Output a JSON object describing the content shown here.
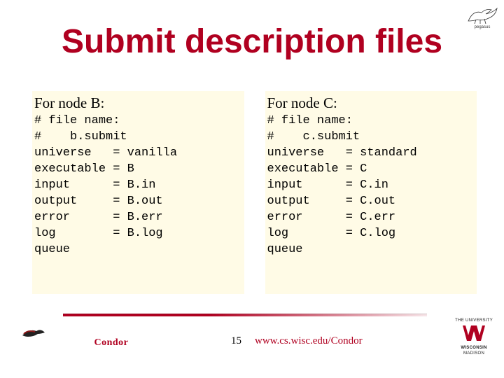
{
  "title": "Submit description files",
  "page_number": "15",
  "footer_url": "www.cs.wisc.edu/Condor",
  "pegasus_label": "pegasus",
  "condor_label": "Condor",
  "wisc_top": "THE UNIVERSITY",
  "wisc_mid": "WISCONSIN",
  "wisc_bot": "MADISON",
  "columns": [
    {
      "header": "For node B:",
      "code": "# file name:\n#    b.submit\nuniverse   = vanilla\nexecutable = B\ninput      = B.in\noutput     = B.out\nerror      = B.err\nlog        = B.log\nqueue"
    },
    {
      "header": "For node C:",
      "code": "# file name:\n#    c.submit\nuniverse   = standard\nexecutable = C\ninput      = C.in\noutput     = C.out\nerror      = C.err\nlog        = C.log\nqueue"
    }
  ]
}
